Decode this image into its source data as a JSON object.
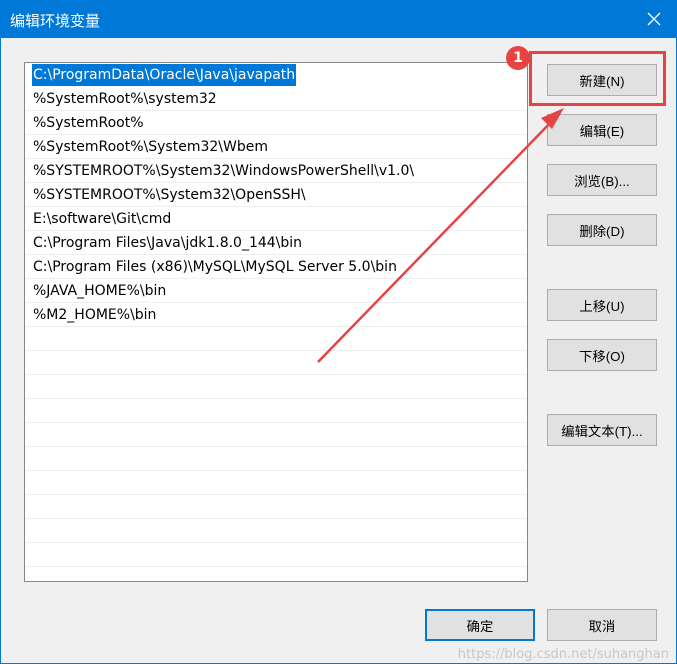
{
  "window": {
    "title": "编辑环境变量"
  },
  "paths": [
    "C:\\ProgramData\\Oracle\\Java\\javapath",
    "%SystemRoot%\\system32",
    "%SystemRoot%",
    "%SystemRoot%\\System32\\Wbem",
    "%SYSTEMROOT%\\System32\\WindowsPowerShell\\v1.0\\",
    "%SYSTEMROOT%\\System32\\OpenSSH\\",
    "E:\\software\\Git\\cmd",
    "C:\\Program Files\\Java\\jdk1.8.0_144\\bin",
    "C:\\Program Files (x86)\\MySQL\\MySQL Server 5.0\\bin",
    "%JAVA_HOME%\\bin",
    "%M2_HOME%\\bin",
    "",
    "",
    "",
    "",
    "",
    "",
    "",
    "",
    "",
    ""
  ],
  "buttons": {
    "new": "新建(N)",
    "edit": "编辑(E)",
    "browse": "浏览(B)...",
    "delete": "删除(D)",
    "move_up": "上移(U)",
    "move_down": "下移(O)",
    "edit_text": "编辑文本(T)...",
    "ok": "确定",
    "cancel": "取消"
  },
  "annotation": {
    "badge": "1",
    "color": "#e64343"
  },
  "watermark": "https://blog.csdn.net/suhanghan",
  "colors": {
    "titlebar": "#0078d7",
    "selection": "#0078d7",
    "background": "#f0f0f0"
  }
}
